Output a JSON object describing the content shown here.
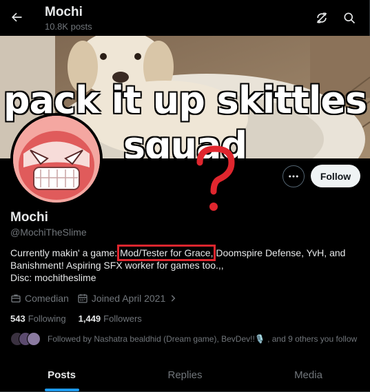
{
  "header": {
    "title": "Mochi",
    "posts_count": "10.8K posts",
    "back_icon": "arrow-left-icon",
    "subscribe_icon": "refresh-off-icon",
    "search_icon": "search-icon"
  },
  "banner": {
    "line1": "pack it up skittles",
    "line2": "squad"
  },
  "profile": {
    "name": "Mochi",
    "handle": "@MochiTheSlime",
    "bio_line1_pre": "Currently makin' a game: ",
    "bio_line1_highlight": "Mod/Tester for Grace,",
    "bio_line1_post": " Doomspire Defense, YvH, and",
    "bio_line2": "Banishment! Aspiring SFX worker for games too.,,",
    "bio_line3": "Disc: mochitheslime",
    "category": "Comedian",
    "joined": "Joined April 2021",
    "following_count": "543",
    "following_label": "Following",
    "followers_count": "1,449",
    "followers_label": "Followers",
    "followed_by": "Followed by Nashatra bealdhid (Dream game), BevDev!!🎙️ , and 9 others you follow"
  },
  "actions": {
    "follow_label": "Follow",
    "more_icon": "more-horizontal-icon"
  },
  "tabs": [
    {
      "label": "Posts",
      "active": true
    },
    {
      "label": "Replies",
      "active": false
    },
    {
      "label": "Media",
      "active": false
    }
  ],
  "colors": {
    "background": "#000000",
    "accent": "#1d9bf0",
    "annotation_red": "#e0262e",
    "muted_text": "#71767b"
  }
}
